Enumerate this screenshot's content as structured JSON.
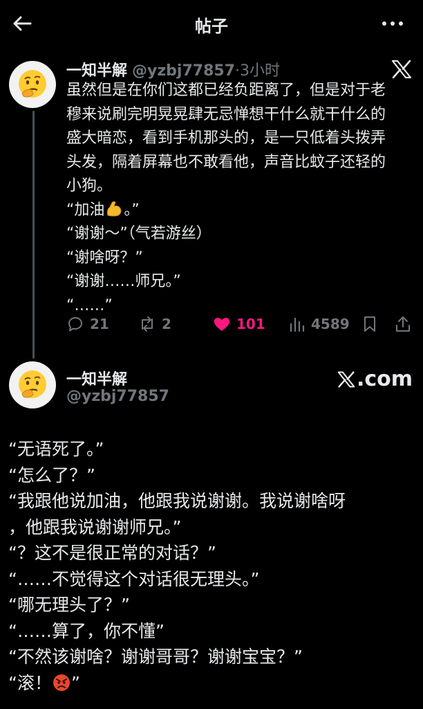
{
  "header": {
    "title": "帖子"
  },
  "post1": {
    "author_name": "一知半解",
    "handle": "@yzbj77857",
    "separator": "·",
    "time": "3小时",
    "lines": [
      "虽然但是在你们这都已经负距离了，但是对于老",
      "穆来说刷完明晃晃肆无忌惮想干什么就干什么的",
      "盛大暗恋，看到手机那头的，是一只低着头拨弄",
      "头发，隔着屏幕也不敢看他，声音比蚊子还轻的",
      "小狗。"
    ],
    "dialog_1a": "“加油",
    "dialog_1b": "。”",
    "dialog_2": "“谢谢～”（气若游丝）",
    "dialog_3": "“谢啥呀？”",
    "dialog_4": "“谢谢……师兄。”",
    "dialog_5": "“……”",
    "stats": {
      "replies": "21",
      "reposts": "2",
      "likes": "101",
      "views": "4589"
    }
  },
  "post2": {
    "author_name": "一知半解",
    "handle": "@yzbj77857",
    "brand": ".com",
    "lines": [
      "“无语死了。”",
      "“怎么了？”",
      "“我跟他说加油，他跟我说谢谢。我说谢啥呀",
      "，他跟我说谢谢师兄。”",
      "“？这不是很正常的对话？”",
      "“……不觉得这个对话很无理头。”",
      "“哪无理头了？”",
      "“……算了，你不懂”",
      "“不然该谢啥？谢谢哥哥？谢谢宝宝？”"
    ],
    "last_a": "“滚！",
    "last_b": "”"
  },
  "colors": {
    "like": "#f91880",
    "muted": "#71767b",
    "text": "#e7e9ea",
    "background": "#000000"
  },
  "icons": [
    "back-arrow-icon",
    "more-icon",
    "x-logo-icon",
    "reply-icon",
    "repost-icon",
    "heart-icon",
    "views-icon",
    "bookmark-icon",
    "share-icon",
    "thinking-face-emoji",
    "flexed-biceps-emoji",
    "angry-face-emoji"
  ]
}
